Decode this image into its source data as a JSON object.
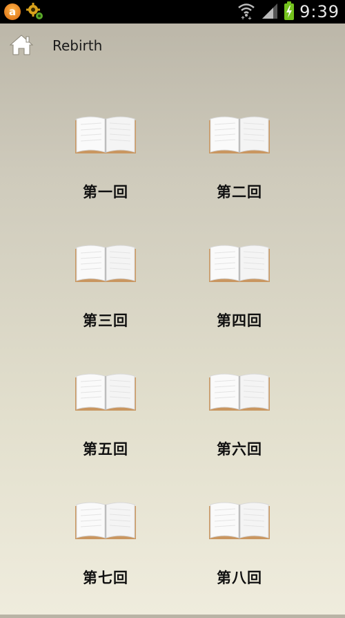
{
  "status_bar": {
    "time": "9:39",
    "left_icons": [
      "app-notification-icon",
      "gear-icon"
    ],
    "right_icons": [
      "wifi-icon",
      "signal-icon",
      "battery-icon"
    ]
  },
  "header": {
    "title": "Rebirth",
    "home_icon": "home-icon"
  },
  "chapters": [
    {
      "label": "第一回"
    },
    {
      "label": "第二回"
    },
    {
      "label": "第三回"
    },
    {
      "label": "第四回"
    },
    {
      "label": "第五回"
    },
    {
      "label": "第六回"
    },
    {
      "label": "第七回"
    },
    {
      "label": "第八回"
    }
  ],
  "colors": {
    "status_bar_bg": "#000000",
    "background_top": "#b9b4a6",
    "background_bottom": "#efecdd",
    "battery": "#74c21d"
  }
}
